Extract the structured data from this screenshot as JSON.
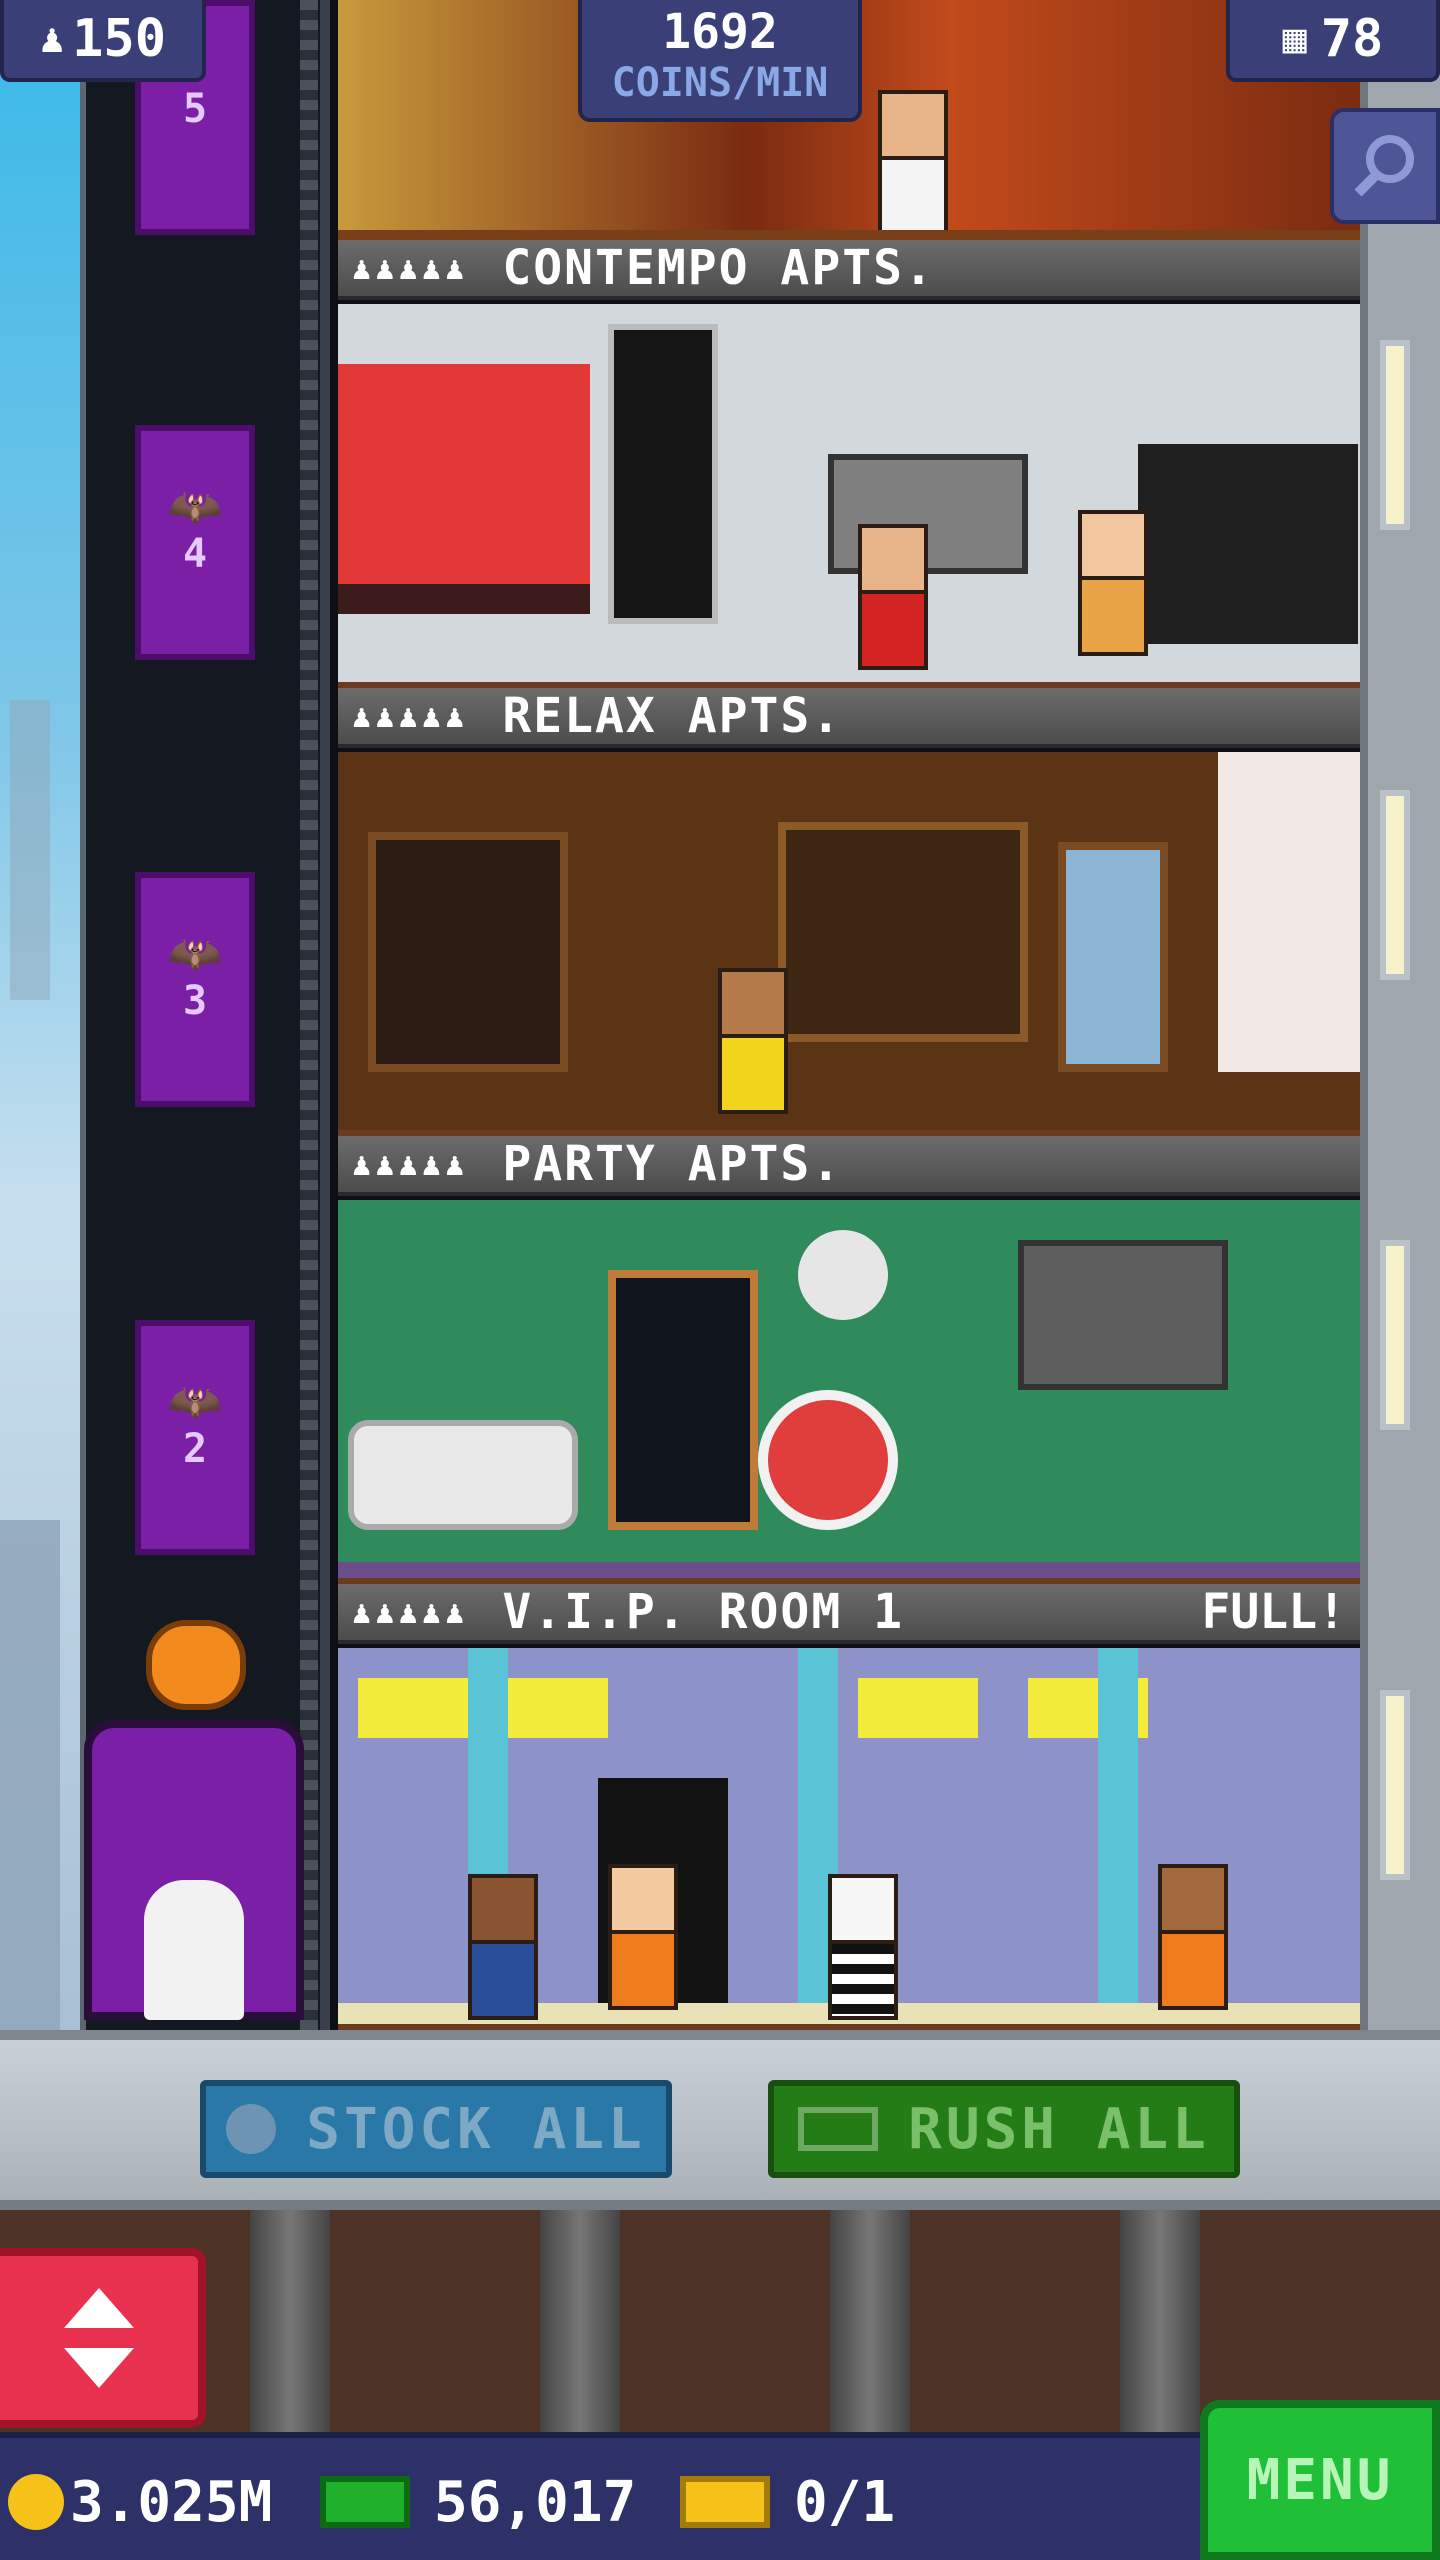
{
  "hud": {
    "population": "150",
    "coins_per_min_value": "1692",
    "coins_per_min_unit": "COINS/MIN",
    "floors_count": "78"
  },
  "elevator": {
    "floor_labels": [
      "5",
      "4",
      "3",
      "2"
    ]
  },
  "floors": [
    {
      "stars": "♟♟♟♟♟",
      "name": "CONTEMPO APTS.",
      "status": ""
    },
    {
      "stars": "♟♟♟♟♟",
      "name": "RELAX APTS.",
      "status": ""
    },
    {
      "stars": "♟♟♟♟♟",
      "name": "PARTY APTS.",
      "status": ""
    },
    {
      "stars": "♟♟♟♟♟",
      "name": "V.I.P. ROOM 1",
      "status": "FULL!"
    }
  ],
  "actions": {
    "stock_all": "STOCK ALL",
    "rush_all": "RUSH ALL"
  },
  "resources": {
    "coins": "3.025M",
    "bux": "56,017",
    "tickets": "0/1"
  },
  "menu_label": "MENU",
  "colors": {
    "hud_blue": "#3b3f77",
    "stock_blue": "#2a78a8",
    "rush_green": "#247c17",
    "menu_green": "#1fc038",
    "elevator_red": "#e8314e",
    "door_purple": "#7a1fa6"
  }
}
